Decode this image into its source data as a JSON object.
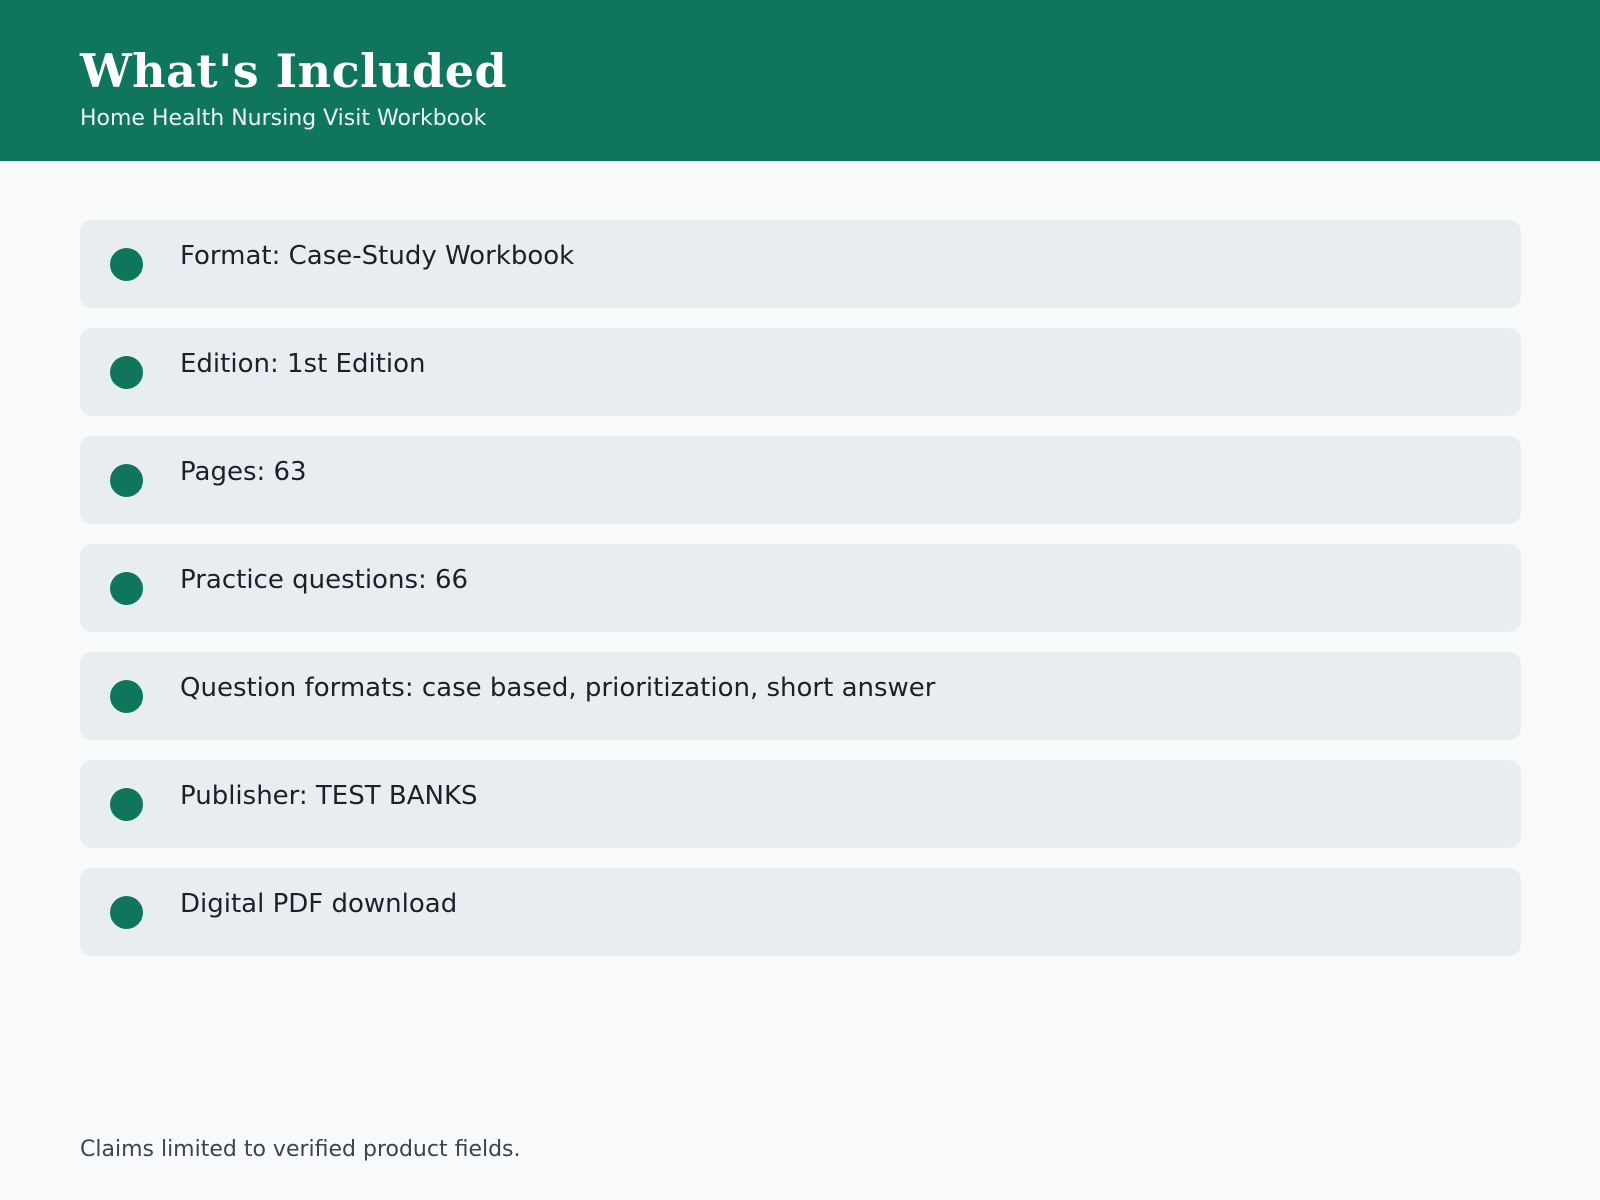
{
  "header": {
    "title": "What's Included",
    "subtitle": "Home Health Nursing Visit Workbook"
  },
  "items": [
    {
      "label": "Format: Case-Study Workbook",
      "icon": "bullet-dot-icon"
    },
    {
      "label": "Edition: 1st Edition",
      "icon": "bullet-dot-icon"
    },
    {
      "label": "Pages: 63",
      "icon": "bullet-dot-icon"
    },
    {
      "label": "Practice questions: 66",
      "icon": "bullet-dot-icon"
    },
    {
      "label": "Question formats: case based, prioritization, short answer",
      "icon": "bullet-dot-icon"
    },
    {
      "label": "Publisher: TEST BANKS",
      "icon": "bullet-dot-icon"
    },
    {
      "label": "Digital PDF download",
      "icon": "bullet-dot-icon"
    }
  ],
  "footer": {
    "note": "Claims limited to verified product fields."
  },
  "colors": {
    "brand": "#0f765d",
    "page_background": "#f7f9fa",
    "card_background": "#e8eef0",
    "text": "#1a202c"
  }
}
